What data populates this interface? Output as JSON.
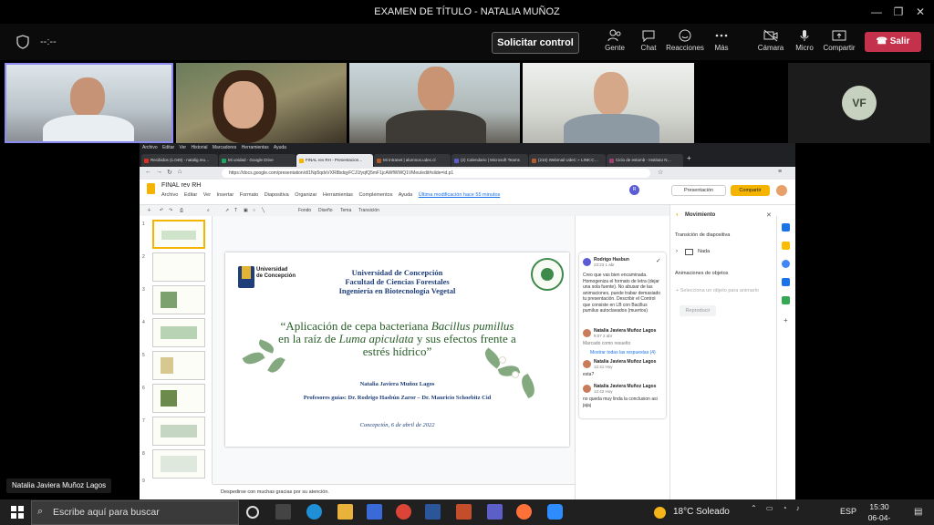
{
  "window": {
    "title": "EXAMEN DE TÍTULO - NATALIA MUÑOZ"
  },
  "toolbar": {
    "timer": "--:--",
    "control_label": "Solicitar control",
    "people_label": "Gente",
    "chat_label": "Chat",
    "reactions_label": "Reacciones",
    "more_label": "Más",
    "camera_label": "Cámara",
    "mic_label": "Micro",
    "share_label": "Compartir",
    "leave_label": "Salir"
  },
  "participants": {
    "vf_initials": "VF",
    "presenter_name": "Natalia Javiera Muñoz Lagos"
  },
  "browser": {
    "menu": [
      "Archivo",
      "Editar",
      "Ver",
      "Historial",
      "Marcadores",
      "Herramientas",
      "Ayuda"
    ],
    "tabs": [
      "Recibidos (1.049) - natalig.mu…",
      "Mi unidad - Google Drive",
      "FINAL rev RH - Presentacion…",
      "Mi Intranet | alumnos.udec.cl",
      "(2) Calendario | Microsoft Teams",
      "(210) Webmail UdeC » LINK:C…",
      "Ciclo de estomb - Instituto N…"
    ],
    "url": "https://docs.google.com/presentation/d/1Np5qdvVXR8bdqyFCJ1fyqfQ5mF1jcAWfWWQ1VMeu/edit#slide=id.p1"
  },
  "slides": {
    "doc_title": "FINAL rev RH",
    "menu": [
      "Archivo",
      "Editar",
      "Ver",
      "Insertar",
      "Formato",
      "Diapositiva",
      "Organizar",
      "Herramientas",
      "Complementos",
      "Ayuda"
    ],
    "last_modified": "Última modificación hace 55 minutos",
    "present_label": "Presentación",
    "share_label": "Compartir",
    "comment_initial": "R",
    "format_bar": [
      "Fondo",
      "Diseño",
      "Tema",
      "Transición"
    ],
    "thumb_numbers": [
      "1",
      "2",
      "3",
      "4",
      "5",
      "6",
      "7",
      "8",
      "9"
    ],
    "notes": "Despedirse con muchas gracias por su atención."
  },
  "slide": {
    "univ_logo_line1": "Universidad",
    "univ_logo_line2": "de Concepción",
    "university": "Universidad de Concepción",
    "faculty": "Facultad de Ciencias Forestales",
    "degree": "Ingeniería en Biotecnología Vegetal",
    "title_part1": "“Aplicación de cepa bacteriana ",
    "title_italic1": "Bacillus pumillus",
    "title_part2": " en la raíz de ",
    "title_italic2": "Luma apiculata",
    "title_part3": " y sus efectos frente a estrés hídrico”",
    "author": "Natalia Javiera Muñoz Lagos",
    "advisors": "Profesores guías: Dr. Rodrigo Hasbún Zaror – Dr. Mauricio Schoebitz Cid",
    "place_date": "Concepción, 6 de abril de 2022"
  },
  "comments": {
    "c1_name": "Rodrigo Hasbun",
    "c1_time": "23:23 1 abr",
    "c1_text": "Creo que vas bien encaminada. Homogeniza el formato de letra (dejar una sola fuente). No abusar de las animaciones, puede trabar demasiado tu presentación. Describir el Control que consiste en LB con Bacillus pumilus autoclavados (muertos)",
    "c2_name": "Natalia Javiera Muñoz Lagos",
    "c2_time": "9:07 2 abr",
    "c2_text": "Marcado como resuelto",
    "show_all": "Mostrar todas las respuestas (4)",
    "c3_name": "Natalia Javiera Muñoz Lagos",
    "c3_time": "12:41 Hoy",
    "c3_text": "esta?",
    "c4_name": "Natalia Javiera Muñoz Lagos",
    "c4_time": "12:42 Hoy",
    "c4_text": "no queda muy linda la conclusion asi jajaj"
  },
  "motion": {
    "title": "Movimiento",
    "transition_heading": "Transición de diapositiva",
    "transition_value": "Nada",
    "animations_heading": "Animaciones de objetos",
    "select_hint": "Selecciona un objeto para animarlo",
    "play_label": "Reproducir"
  },
  "taskbar": {
    "search_placeholder": "Escribe aquí para buscar",
    "weather": "18°C  Soleado",
    "lang": "ESP",
    "time": "15:30",
    "date": "06-04-2022"
  },
  "colors": {
    "leave": "#c4314b",
    "slides_yellow": "#f4b400",
    "title_green": "#2a5e2a",
    "navy": "#1f3f7a"
  }
}
